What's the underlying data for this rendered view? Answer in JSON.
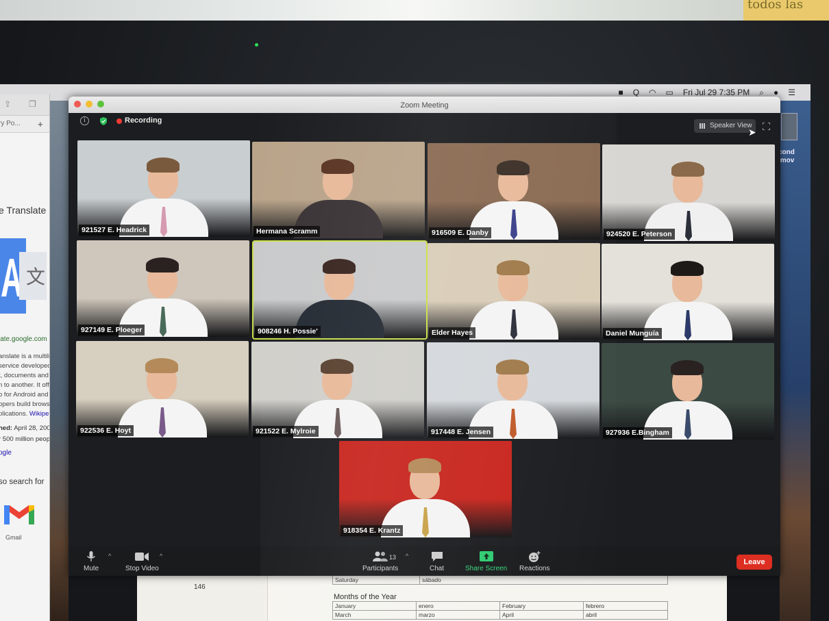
{
  "sticky_note": "todos las",
  "menubar": {
    "clock": "Fri Jul 29  7:35 PM",
    "icons": [
      "zoom-icon",
      "q-icon",
      "wifi-icon",
      "airplay-icon",
      "search-icon",
      "user-icon",
      "list-icon"
    ]
  },
  "desktop": {
    "file_label_line1": "cond",
    "file_label_line2": ".mov"
  },
  "browser": {
    "tab_title": "ry Po...",
    "heading": "e Translate",
    "url": "late.google.com",
    "snippet_lines": [
      "anslate is a multilin",
      "service developed",
      "t, documents and",
      "n to another. It offe",
      "o for Android and",
      "opers build brows",
      "plications."
    ],
    "snippet_link": "Wikipe",
    "launched_label": "hed:",
    "launched_value": "April 28, 200",
    "users_line": "r 500 million peop",
    "google_link": "ogle",
    "also_search": "so search for",
    "gmail_label": "Gmail"
  },
  "paper": {
    "page_number": "146",
    "saturday": [
      "Saturday",
      "sábado"
    ],
    "months_title": "Months of the Year",
    "months_rows": [
      [
        "January",
        "enero",
        "February",
        "febrero"
      ],
      [
        "March",
        "marzo",
        "April",
        "abril"
      ]
    ]
  },
  "zoom": {
    "window_title": "Zoom Meeting",
    "recording_label": "Recording",
    "speaker_view_label": "Speaker View",
    "participants": [
      {
        "name": "921527 E. Headrick",
        "wall": "#c9ced1",
        "shirt": "#f4f4f4",
        "tie": "#d59ab0",
        "hair": "#7a5a3c",
        "active": false
      },
      {
        "name": "Hermana Scramm",
        "wall": "#b9a48a",
        "shirt": "#3a3336",
        "tie": "#3a3336",
        "hair": "#5a3424",
        "active": false
      },
      {
        "name": "916509 E. Danby",
        "wall": "#8a6a52",
        "shirt": "#f5f5f5",
        "tie": "#3a3f8a",
        "hair": "#3a2e26",
        "active": false
      },
      {
        "name": "924520 E. Peterson",
        "wall": "#d8d6d2",
        "shirt": "#f0f0f0",
        "tie": "#2a2f3a",
        "hair": "#8a6a4a",
        "active": false
      },
      {
        "name": "927149 E. Ploeger",
        "wall": "#cfc7bc",
        "shirt": "#f5f5f5",
        "tie": "#4a6a5a",
        "hair": "#2a2220",
        "active": false
      },
      {
        "name": "908246 H. Possie'",
        "wall": "#c9cacb",
        "shirt": "#242a33",
        "tie": "#242a33",
        "hair": "#3a2620",
        "active": true
      },
      {
        "name": "Elder Hayes",
        "wall": "#d9cdb8",
        "shirt": "#f4f4f4",
        "tie": "#2c2f3a",
        "hair": "#a07a4a",
        "active": false
      },
      {
        "name": "Daniel Munguía",
        "wall": "#e4e1da",
        "shirt": "#f4f4f4",
        "tie": "#2c3a6a",
        "hair": "#1e1a18",
        "active": false
      },
      {
        "name": "922536 E. Hoyt",
        "wall": "#d7cfbf",
        "shirt": "#f4f4f4",
        "tie": "#7a5a8a",
        "hair": "#b58a5a",
        "active": false
      },
      {
        "name": "921522 E. Mylroie",
        "wall": "#d0cfca",
        "shirt": "#f4f4f4",
        "tie": "#6a5a5a",
        "hair": "#5a4230",
        "active": false
      },
      {
        "name": "917448 E. Jensen",
        "wall": "#d4d8dc",
        "shirt": "#f4f4f4",
        "tie": "#c05a2a",
        "hair": "#a07a4a",
        "active": false
      },
      {
        "name": "927936 E.Bingham",
        "wall": "#3c4a44",
        "shirt": "#f4f4f4",
        "tie": "#3a4a6a",
        "hair": "#2a2220",
        "active": false
      },
      {
        "name": "918354 E. Krantz",
        "wall": "#c8261e",
        "shirt": "#f4f4f4",
        "tie": "#c9a24a",
        "hair": "#b58a5a",
        "active": false
      }
    ],
    "toolbar": {
      "mute_label": "Mute",
      "stop_video_label": "Stop Video",
      "participants_label": "Participants",
      "participants_count": "13",
      "chat_label": "Chat",
      "share_label": "Share Screen",
      "reactions_label": "Reactions",
      "leave_label": "Leave"
    }
  }
}
